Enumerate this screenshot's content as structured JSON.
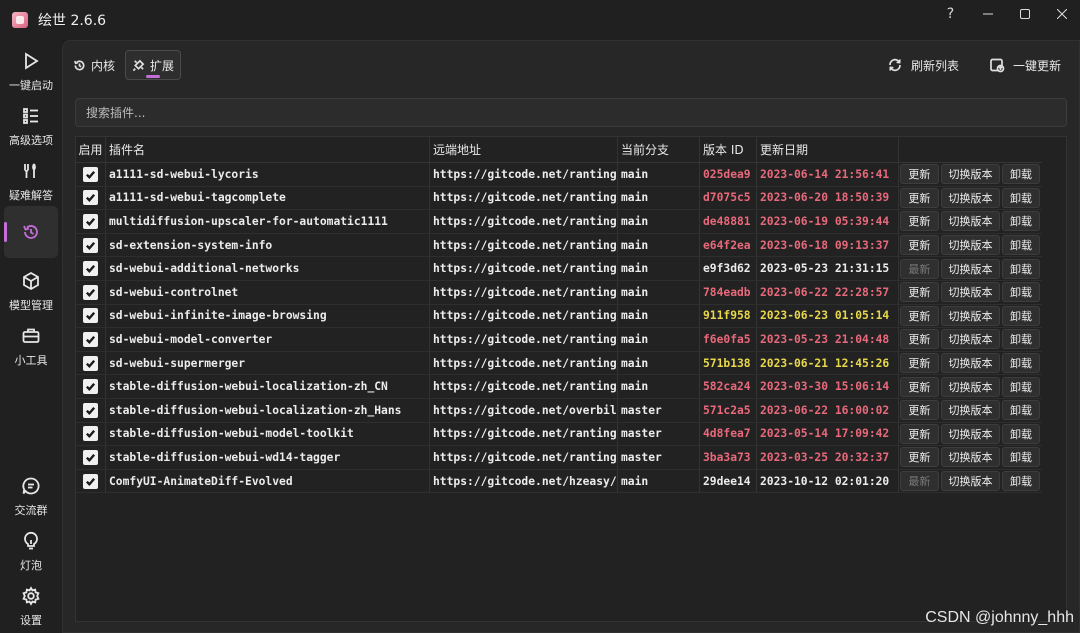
{
  "window": {
    "title": "绘世 2.6.6",
    "controls": [
      "?",
      "minimize",
      "maximize",
      "close"
    ]
  },
  "sidebar": {
    "items": [
      {
        "label": "一键启动",
        "icon": "play-icon"
      },
      {
        "label": "高级选项",
        "icon": "list-icon"
      },
      {
        "label": "疑难解答",
        "icon": "tools-icon"
      },
      {
        "label": "",
        "icon": "history-icon",
        "active": true
      },
      {
        "label": "模型管理",
        "icon": "cube-icon"
      },
      {
        "label": "小工具",
        "icon": "toolbox-icon"
      },
      {
        "label": "交流群",
        "icon": "chat-icon"
      },
      {
        "label": "灯泡",
        "icon": "lightbulb-icon"
      },
      {
        "label": "设置",
        "icon": "gear-icon"
      }
    ]
  },
  "tabs": [
    {
      "label": "内核",
      "icon": "history-icon"
    },
    {
      "label": "扩展",
      "icon": "plugin-icon",
      "active": true
    }
  ],
  "actions": {
    "refresh": "刷新列表",
    "update_all": "一键更新"
  },
  "search": {
    "placeholder": "搜索插件..."
  },
  "table": {
    "headers": [
      "启用",
      "插件名",
      "远端地址",
      "当前分支",
      "版本 ID",
      "更新日期"
    ],
    "buttons": {
      "update": "更新",
      "latest": "最新",
      "switch": "切换版本",
      "uninstall": "卸载"
    },
    "rows": [
      {
        "enabled": true,
        "name": "a1111-sd-webui-lycoris",
        "url": "https://gitcode.net/ranting",
        "branch": "main",
        "id": "025dea9",
        "date": "2023-06-14 21:56:41",
        "status": "outdated"
      },
      {
        "enabled": true,
        "name": "a1111-sd-webui-tagcomplete",
        "url": "https://gitcode.net/ranting",
        "branch": "main",
        "id": "d7075c5",
        "date": "2023-06-20 18:50:39",
        "status": "outdated"
      },
      {
        "enabled": true,
        "name": "multidiffusion-upscaler-for-automatic1111",
        "url": "https://gitcode.net/ranting",
        "branch": "main",
        "id": "de48881",
        "date": "2023-06-19 05:39:44",
        "status": "outdated"
      },
      {
        "enabled": true,
        "name": "sd-extension-system-info",
        "url": "https://gitcode.net/ranting",
        "branch": "main",
        "id": "e64f2ea",
        "date": "2023-06-18 09:13:37",
        "status": "outdated"
      },
      {
        "enabled": true,
        "name": "sd-webui-additional-networks",
        "url": "https://gitcode.net/ranting",
        "branch": "main",
        "id": "e9f3d62",
        "date": "2023-05-23 21:31:15",
        "status": "latest"
      },
      {
        "enabled": true,
        "name": "sd-webui-controlnet",
        "url": "https://gitcode.net/ranting",
        "branch": "main",
        "id": "784eadb",
        "date": "2023-06-22 22:28:57",
        "status": "outdated"
      },
      {
        "enabled": true,
        "name": "sd-webui-infinite-image-browsing",
        "url": "https://gitcode.net/ranting",
        "branch": "main",
        "id": "911f958",
        "date": "2023-06-23 01:05:14",
        "status": "warning"
      },
      {
        "enabled": true,
        "name": "sd-webui-model-converter",
        "url": "https://gitcode.net/ranting",
        "branch": "main",
        "id": "f6e0fa5",
        "date": "2023-05-23 21:04:48",
        "status": "outdated"
      },
      {
        "enabled": true,
        "name": "sd-webui-supermerger",
        "url": "https://gitcode.net/ranting",
        "branch": "main",
        "id": "571b138",
        "date": "2023-06-21 12:45:26",
        "status": "warning"
      },
      {
        "enabled": true,
        "name": "stable-diffusion-webui-localization-zh_CN",
        "url": "https://gitcode.net/ranting",
        "branch": "main",
        "id": "582ca24",
        "date": "2023-03-30 15:06:14",
        "status": "outdated"
      },
      {
        "enabled": true,
        "name": "stable-diffusion-webui-localization-zh_Hans",
        "url": "https://gitcode.net/overbil",
        "branch": "master",
        "id": "571c2a5",
        "date": "2023-06-22 16:00:02",
        "status": "outdated"
      },
      {
        "enabled": true,
        "name": "stable-diffusion-webui-model-toolkit",
        "url": "https://gitcode.net/ranting",
        "branch": "master",
        "id": "4d8fea7",
        "date": "2023-05-14 17:09:42",
        "status": "outdated"
      },
      {
        "enabled": true,
        "name": "stable-diffusion-webui-wd14-tagger",
        "url": "https://gitcode.net/ranting",
        "branch": "master",
        "id": "3ba3a73",
        "date": "2023-03-25 20:32:37",
        "status": "outdated"
      },
      {
        "enabled": true,
        "name": "ComfyUI-AnimateDiff-Evolved",
        "url": "https://gitcode.net/hzeasy/",
        "branch": "main",
        "id": "29dee14",
        "date": "2023-10-12 02:01:20",
        "status": "latest"
      }
    ]
  },
  "colors": {
    "outdated": "#e8697b",
    "warning": "#e8d84a",
    "latest": "#ececec",
    "accent": "#c36ed8"
  },
  "watermark": "CSDN @johnny_hhh"
}
